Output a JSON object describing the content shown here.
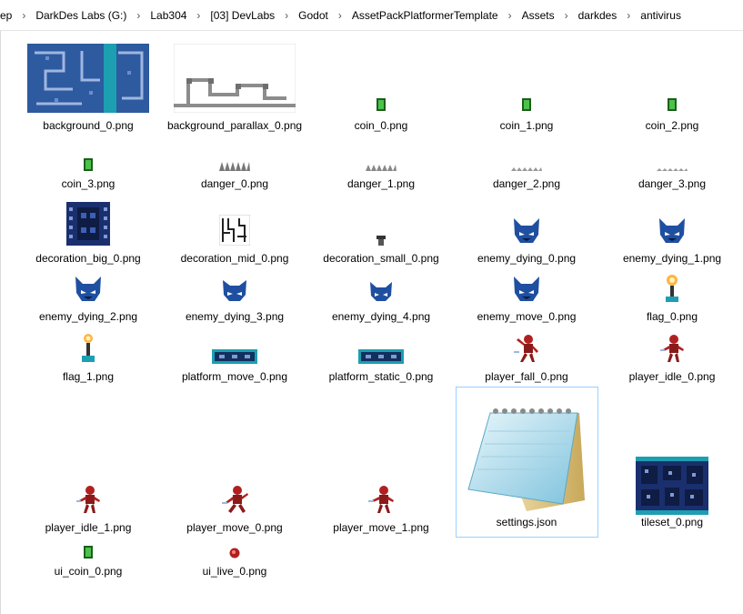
{
  "breadcrumb": [
    "rep",
    "DarkDes Labs (G:)",
    "Lab304",
    "[03] DevLabs",
    "Godot",
    "AssetPackPlatformerTemplate",
    "Assets",
    "darkdes",
    "antivirus"
  ],
  "files": [
    {
      "name": "background_0.png",
      "icon": "blue-maze-tile-thumbnail"
    },
    {
      "name": "background_parallax_0.png",
      "icon": "gray-pipes-thumbnail"
    },
    {
      "name": "coin_0.png",
      "icon": "green-coin-icon"
    },
    {
      "name": "coin_1.png",
      "icon": "green-coin-icon"
    },
    {
      "name": "coin_2.png",
      "icon": "green-coin-icon"
    },
    {
      "name": "coin_3.png",
      "icon": "green-coin-icon"
    },
    {
      "name": "danger_0.png",
      "icon": "spikes-icon"
    },
    {
      "name": "danger_1.png",
      "icon": "spikes-icon"
    },
    {
      "name": "danger_2.png",
      "icon": "spikes-icon"
    },
    {
      "name": "danger_3.png",
      "icon": "spikes-icon"
    },
    {
      "name": "decoration_big_0.png",
      "icon": "circuit-board-icon"
    },
    {
      "name": "decoration_mid_0.png",
      "icon": "circuit-lines-icon"
    },
    {
      "name": "decoration_small_0.png",
      "icon": "small-chip-icon"
    },
    {
      "name": "enemy_dying_0.png",
      "icon": "blue-cat-enemy-icon"
    },
    {
      "name": "enemy_dying_1.png",
      "icon": "blue-cat-enemy-icon"
    },
    {
      "name": "enemy_dying_2.png",
      "icon": "blue-cat-enemy-icon"
    },
    {
      "name": "enemy_dying_3.png",
      "icon": "blue-cat-enemy-icon"
    },
    {
      "name": "enemy_dying_4.png",
      "icon": "blue-cat-enemy-icon"
    },
    {
      "name": "enemy_move_0.png",
      "icon": "blue-cat-enemy-icon"
    },
    {
      "name": "flag_0.png",
      "icon": "flag-icon"
    },
    {
      "name": "flag_1.png",
      "icon": "flag-icon"
    },
    {
      "name": "platform_move_0.png",
      "icon": "platform-icon"
    },
    {
      "name": "platform_static_0.png",
      "icon": "platform-icon"
    },
    {
      "name": "player_fall_0.png",
      "icon": "red-robot-player-icon"
    },
    {
      "name": "player_idle_0.png",
      "icon": "red-robot-player-icon"
    },
    {
      "name": "player_idle_1.png",
      "icon": "red-robot-player-icon"
    },
    {
      "name": "player_move_0.png",
      "icon": "red-robot-player-icon"
    },
    {
      "name": "player_move_1.png",
      "icon": "red-robot-player-icon"
    },
    {
      "name": "settings.json",
      "icon": "notepad-icon"
    },
    {
      "name": "tileset_0.png",
      "icon": "tileset-thumbnail"
    },
    {
      "name": "ui_coin_0.png",
      "icon": "green-coin-icon"
    },
    {
      "name": "ui_live_0.png",
      "icon": "heart-live-icon"
    }
  ],
  "selected_file": "settings.json",
  "colors": {
    "selection_border": "#99d1ff",
    "maze_blue": "#2e5aa0",
    "coin_green": "#2f8f2f",
    "enemy_blue": "#1f4fa0",
    "player_red": "#b02020"
  }
}
